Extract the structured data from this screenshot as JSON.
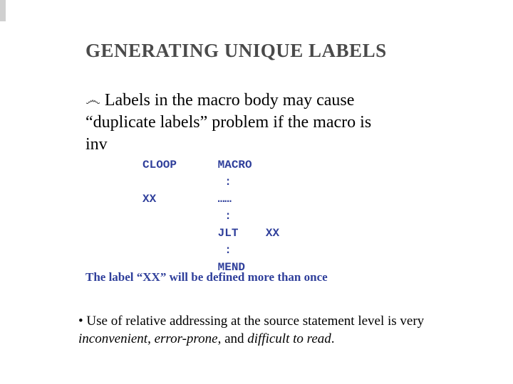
{
  "title": "GENERATING UNIQUE LABELS",
  "bullet_glyph": "෴",
  "body": {
    "line1": "Labels in the macro body may cause",
    "line2": "“duplicate labels” problem if the macro is",
    "line3": "inv"
  },
  "code": {
    "l1a": "CLOOP",
    "l1b": "MACRO",
    "l2": ":",
    "l3": "XX",
    "l3b": "……",
    "l4": ":",
    "l5a": "JLT",
    "l5b": "XX",
    "l6": ":",
    "l7": "MEND"
  },
  "caption": "The label “XX” will be defined more than once",
  "footer": {
    "pre": "• Use of relative addressing at the source statement level is very ",
    "em1": "inconvenient",
    "sep1": ", ",
    "em2": "error-prone",
    "sep2": ", and ",
    "em3": "difficult to read",
    "end": "."
  }
}
